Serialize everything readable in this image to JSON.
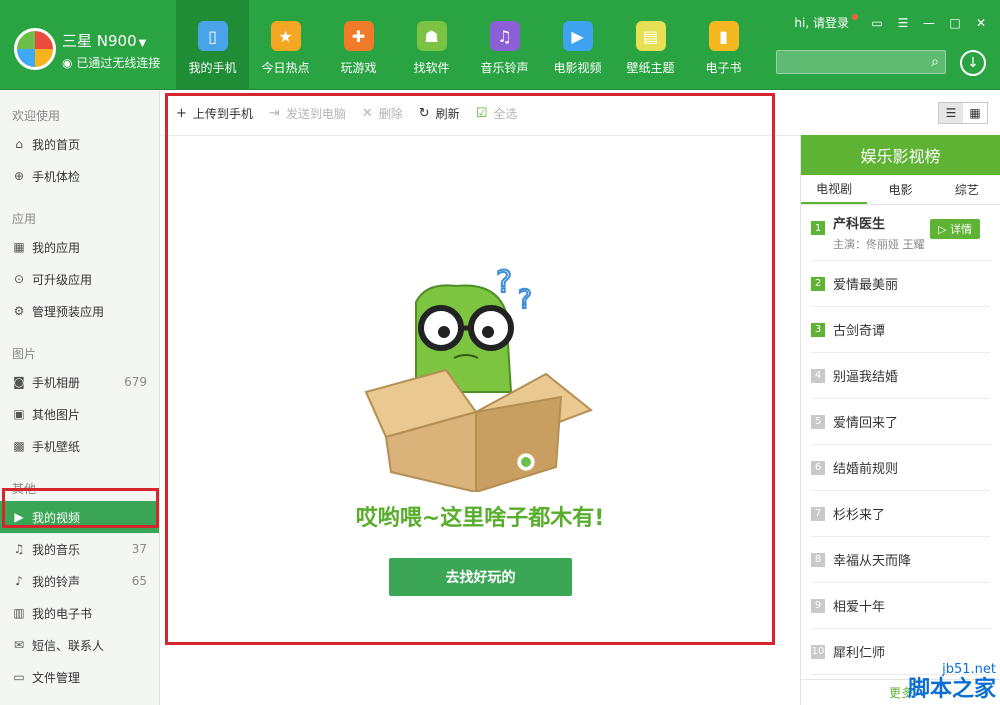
{
  "header": {
    "device_name": "三星 N900",
    "device_status": "已通过无线连接",
    "login": "hi, 请登录",
    "search_placeholder": "",
    "nav": [
      {
        "label": "我的手机",
        "icon": "phone-icon",
        "color": "#4aa3e8"
      },
      {
        "label": "今日热点",
        "icon": "star-icon",
        "color": "#f5a623"
      },
      {
        "label": "玩游戏",
        "icon": "gamepad-icon",
        "color": "#f07a28"
      },
      {
        "label": "找软件",
        "icon": "android-icon",
        "color": "#7cc243"
      },
      {
        "label": "音乐铃声",
        "icon": "music-icon",
        "color": "#8b5fd6"
      },
      {
        "label": "电影视频",
        "icon": "play-icon",
        "color": "#3fa3ef"
      },
      {
        "label": "壁纸主题",
        "icon": "wallpaper-icon",
        "color": "#e7df54"
      },
      {
        "label": "电子书",
        "icon": "book-icon",
        "color": "#f3b720"
      }
    ]
  },
  "sidebar": {
    "sections": [
      {
        "title": "欢迎使用",
        "items": [
          {
            "label": "我的首页",
            "icon": "home-icon",
            "count": ""
          },
          {
            "label": "手机体检",
            "icon": "checkup-icon",
            "count": ""
          }
        ]
      },
      {
        "title": "应用",
        "items": [
          {
            "label": "我的应用",
            "icon": "apps-icon",
            "count": ""
          },
          {
            "label": "可升级应用",
            "icon": "upgrade-icon",
            "count": ""
          },
          {
            "label": "管理预装应用",
            "icon": "gear-icon",
            "count": ""
          }
        ]
      },
      {
        "title": "图片",
        "items": [
          {
            "label": "手机相册",
            "icon": "camera-icon",
            "count": "679"
          },
          {
            "label": "其他图片",
            "icon": "image-icon",
            "count": ""
          },
          {
            "label": "手机壁纸",
            "icon": "wallpaper-small-icon",
            "count": ""
          }
        ]
      },
      {
        "title": "其他",
        "items": [
          {
            "label": "我的视频",
            "icon": "video-icon",
            "count": ""
          },
          {
            "label": "我的音乐",
            "icon": "music-note-icon",
            "count": "37"
          },
          {
            "label": "我的铃声",
            "icon": "bell-icon",
            "count": "65"
          },
          {
            "label": "我的电子书",
            "icon": "ebook-icon",
            "count": ""
          },
          {
            "label": "短信、联系人",
            "icon": "mail-icon",
            "count": ""
          },
          {
            "label": "文件管理",
            "icon": "folder-icon",
            "count": ""
          }
        ]
      }
    ]
  },
  "toolbar": {
    "upload": "上传到手机",
    "send": "发送到电脑",
    "delete": "删除",
    "refresh": "刷新",
    "select_all": "全选"
  },
  "main": {
    "empty_text": "哎哟喂~这里啥子都木有!",
    "find_button": "去找好玩的"
  },
  "rpanel": {
    "title": "娱乐影视榜",
    "tabs": [
      "电视剧",
      "电影",
      "综艺"
    ],
    "top": {
      "rank": "1",
      "title": "产科医生",
      "detail": "主演：佟丽娅 王耀",
      "button": "详情"
    },
    "items": [
      {
        "rank": "2",
        "title": "爱情最美丽"
      },
      {
        "rank": "3",
        "title": "古剑奇谭"
      },
      {
        "rank": "4",
        "title": "别逼我结婚"
      },
      {
        "rank": "5",
        "title": "爱情回来了"
      },
      {
        "rank": "6",
        "title": "结婚前规则"
      },
      {
        "rank": "7",
        "title": "杉杉来了"
      },
      {
        "rank": "8",
        "title": "幸福从天而降"
      },
      {
        "rank": "9",
        "title": "相爱十年"
      },
      {
        "rank": "10",
        "title": "犀利仁师"
      }
    ],
    "footer": "更多"
  },
  "watermark": {
    "url": "jb51.net",
    "cn": "脚本之家"
  },
  "colors": {
    "brand": "#2aa443",
    "accent": "#3aa656",
    "highlight": "#d6262d",
    "chart_green": "#5fb334"
  }
}
